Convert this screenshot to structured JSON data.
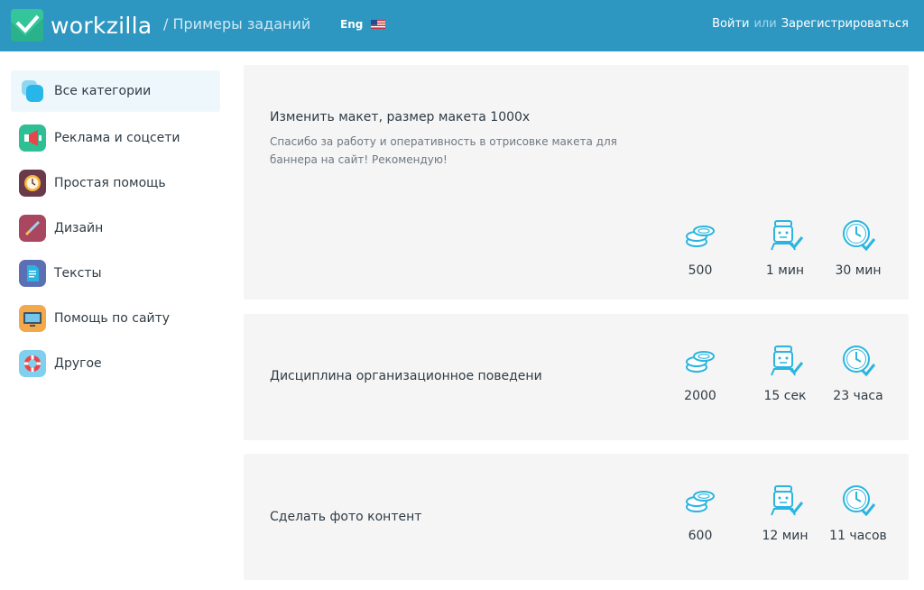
{
  "header": {
    "logo_text": "workzilla",
    "subtitle": "/ Примеры заданий",
    "lang": "Eng",
    "login": "Войти",
    "or": "или",
    "register": "Зарегистрироваться"
  },
  "sidebar": {
    "items": [
      {
        "label": "Все категории",
        "icon": "layers-icon"
      },
      {
        "label": "Реклама и соцсети",
        "icon": "megaphone-icon"
      },
      {
        "label": "Простая помощь",
        "icon": "clock-icon"
      },
      {
        "label": "Дизайн",
        "icon": "brush-icon"
      },
      {
        "label": "Тексты",
        "icon": "document-icon"
      },
      {
        "label": "Помощь по сайту",
        "icon": "monitor-icon"
      },
      {
        "label": "Другое",
        "icon": "lifebuoy-icon"
      }
    ]
  },
  "tasks": [
    {
      "title": "Изменить макет, размер макета 1000х",
      "review": "Спасибо за работу и оперативность в отрисовке макета для баннера на сайт! Рекомендую!",
      "price": "500",
      "response": "1 мин",
      "duration": "30 мин"
    },
    {
      "title": "Дисциплина организационное поведени",
      "review": "",
      "price": "2000",
      "response": "15 сек",
      "duration": "23 часа"
    },
    {
      "title": "Сделать фото контент",
      "review": "",
      "price": "600",
      "response": "12 мин",
      "duration": "11 часов"
    }
  ],
  "colors": {
    "header": "#2d97c2",
    "accent": "#29b5e0",
    "card": "#f5f5f5"
  }
}
